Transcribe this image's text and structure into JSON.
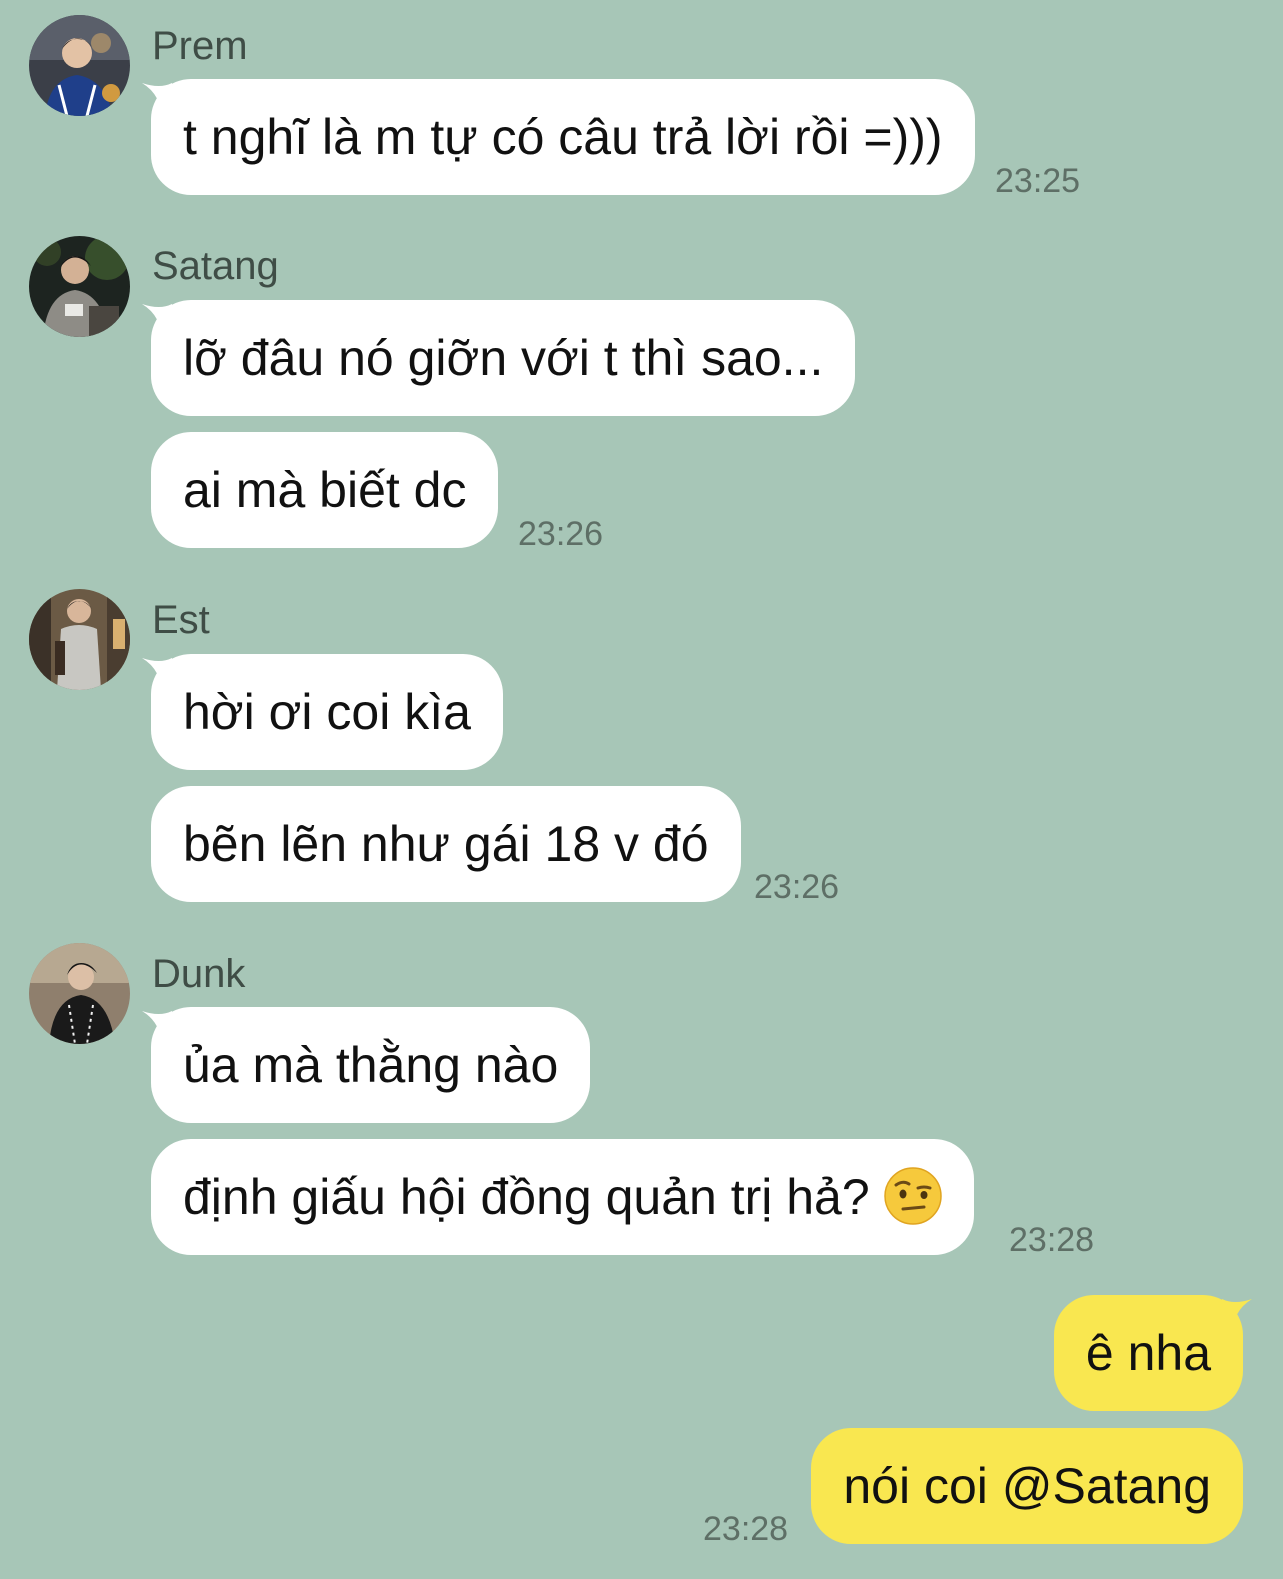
{
  "groups": [
    {
      "sender": "Prem",
      "avatar_icon": "avatar-prem",
      "messages": [
        "t nghĩ là m tự có câu trả lời rồi =)))"
      ],
      "time": "23:25"
    },
    {
      "sender": "Satang",
      "avatar_icon": "avatar-satang",
      "messages": [
        "lỡ đâu nó giỡn với t thì sao...",
        "ai mà biết dc"
      ],
      "time": "23:26"
    },
    {
      "sender": "Est",
      "avatar_icon": "avatar-est",
      "messages": [
        "hời ơi coi kìa",
        "bẽn lẽn như gái 18 v đó"
      ],
      "time": "23:26"
    },
    {
      "sender": "Dunk",
      "avatar_icon": "avatar-dunk",
      "messages": [
        "ủa mà thằng nào",
        "định giấu hội đồng quản trị hả?"
      ],
      "emoji": "face-with-raised-eyebrow",
      "time": "23:28"
    }
  ],
  "outgoing": {
    "messages": [
      "ê nha",
      "nói coi @Satang"
    ],
    "time": "23:28"
  },
  "colors": {
    "background": "#a7c6b7",
    "incoming_bubble": "#ffffff",
    "outgoing_bubble": "#f9e750",
    "timestamp": "#5e6f66"
  }
}
